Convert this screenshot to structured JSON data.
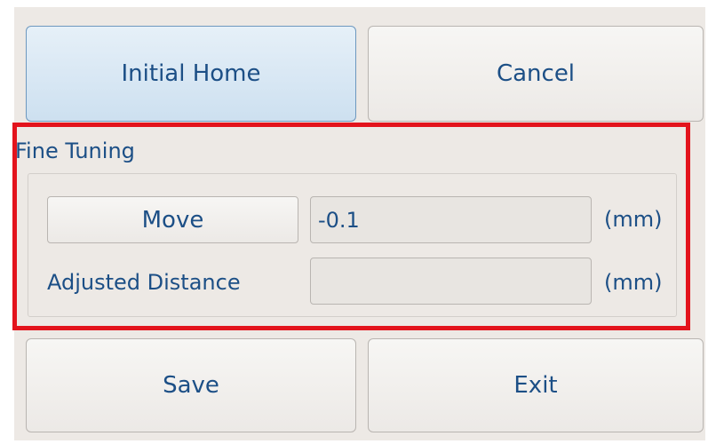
{
  "buttons": {
    "initial_home": "Initial Home",
    "cancel": "Cancel",
    "move": "Move",
    "save": "Save",
    "exit": "Exit"
  },
  "fine_tuning": {
    "title": "Fine Tuning",
    "move_value": "-0.1",
    "move_unit": "(mm)",
    "adjusted_label": "Adjusted Distance",
    "adjusted_value": "",
    "adjusted_unit": "(mm)"
  },
  "colors": {
    "text": "#1c4f86",
    "highlight": "#e3131c",
    "panel": "#ede9e5"
  }
}
